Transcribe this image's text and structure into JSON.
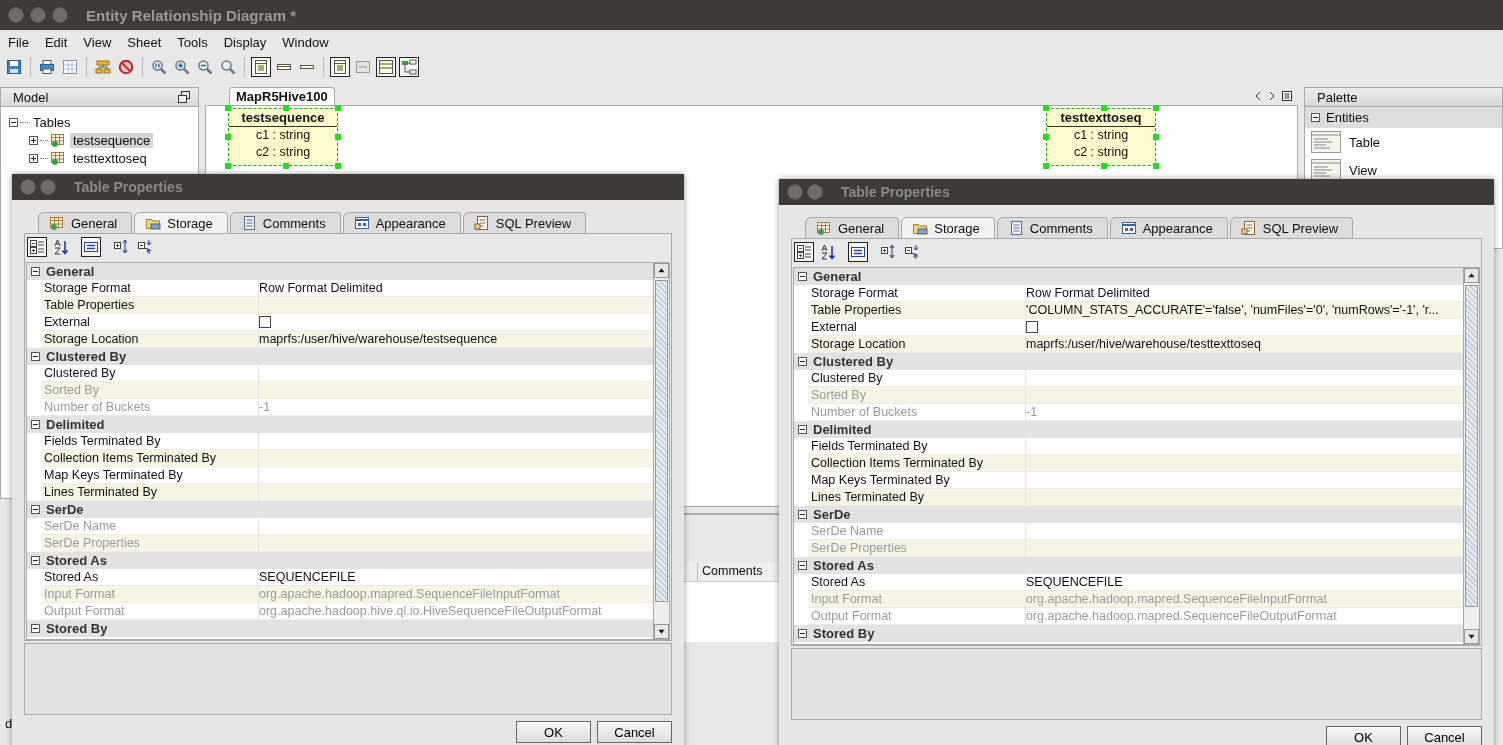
{
  "window": {
    "title": "Entity Relationship Diagram *"
  },
  "menu": [
    "File",
    "Edit",
    "View",
    "Sheet",
    "Tools",
    "Display",
    "Window"
  ],
  "toolbar": [
    {
      "kind": "save",
      "pressed": false
    },
    {
      "kind": "sep"
    },
    {
      "kind": "print",
      "pressed": false
    },
    {
      "kind": "grid",
      "pressed": false
    },
    {
      "kind": "sep"
    },
    {
      "kind": "layout",
      "pressed": false
    },
    {
      "kind": "stop",
      "pressed": false
    },
    {
      "kind": "sep"
    },
    {
      "kind": "zoomfit",
      "pressed": false
    },
    {
      "kind": "zoomin",
      "pressed": false
    },
    {
      "kind": "zoomout",
      "pressed": false
    },
    {
      "kind": "zoom",
      "pressed": false
    },
    {
      "kind": "sep"
    },
    {
      "kind": "entityfull",
      "pressed": true
    },
    {
      "kind": "entitytitle",
      "pressed": false
    },
    {
      "kind": "entityline",
      "pressed": false
    },
    {
      "kind": "sep"
    },
    {
      "kind": "entityfull",
      "pressed": true
    },
    {
      "kind": "nul",
      "pressed": false
    },
    {
      "kind": "window",
      "pressed": true
    },
    {
      "kind": "diagram",
      "pressed": true
    }
  ],
  "model_panel": {
    "title": "Model",
    "tree": [
      {
        "label": "Tables",
        "expanded": true,
        "children": [
          {
            "label": "testsequence",
            "selected": true,
            "expanded": false
          },
          {
            "label": "testtexttoseq",
            "selected": false,
            "expanded": false
          }
        ]
      }
    ]
  },
  "diagram": {
    "tab": "MapR5Hive100",
    "entities": [
      {
        "name": "testsequence",
        "columns": [
          "c1 : string",
          "c2 : string"
        ],
        "selected": true
      },
      {
        "name": "testtexttoseq",
        "columns": [
          "c1 : string",
          "c2 : string"
        ],
        "selected": true
      }
    ]
  },
  "palette": {
    "title": "Palette",
    "group": "Entities",
    "items": [
      "Table",
      "View"
    ]
  },
  "bottom_panel": {
    "column": "Comments"
  },
  "status_text": "d",
  "dialogs": [
    {
      "title": "Table Properties",
      "tabs": [
        {
          "label": "General",
          "kind": "general",
          "selected": false
        },
        {
          "label": "Storage",
          "kind": "storage",
          "selected": true
        },
        {
          "label": "Comments",
          "kind": "comments",
          "selected": false
        },
        {
          "label": "Appearance",
          "kind": "appearance",
          "selected": false
        },
        {
          "label": "SQL Preview",
          "kind": "sql",
          "selected": false
        }
      ],
      "tools": [
        {
          "kind": "categorized",
          "pressed": true
        },
        {
          "kind": "alphabetical",
          "pressed": false
        },
        {
          "kind": "description",
          "pressed": true
        },
        {
          "kind": "expand",
          "pressed": false
        },
        {
          "kind": "collapse",
          "pressed": false
        }
      ],
      "sections": [
        {
          "title": "General",
          "expanded": true,
          "rows": [
            {
              "name": "Storage Format",
              "value": "Row Format Delimited",
              "disabled": false,
              "kind": "text"
            },
            {
              "name": "Table Properties",
              "disabled": false,
              "kind": "text"
            },
            {
              "name": "External",
              "disabled": false,
              "kind": "checkbox",
              "checked": false
            },
            {
              "name": "Storage Location",
              "value": "maprfs:/user/hive/warehouse/testsequence",
              "disabled": false,
              "kind": "text"
            }
          ]
        },
        {
          "title": "Clustered By",
          "expanded": true,
          "rows": [
            {
              "name": "Clustered By",
              "disabled": false,
              "kind": "text"
            },
            {
              "name": "Sorted By",
              "disabled": true,
              "kind": "text"
            },
            {
              "name": "Number of Buckets",
              "value": "-1",
              "disabled": true,
              "kind": "text"
            }
          ]
        },
        {
          "title": "Delimited",
          "expanded": true,
          "rows": [
            {
              "name": "Fields Terminated By",
              "disabled": false,
              "kind": "text"
            },
            {
              "name": "Collection Items Terminated By",
              "disabled": false,
              "kind": "text"
            },
            {
              "name": "Map Keys Terminated By",
              "disabled": false,
              "kind": "text"
            },
            {
              "name": "Lines Terminated By",
              "disabled": false,
              "kind": "text"
            }
          ]
        },
        {
          "title": "SerDe",
          "expanded": true,
          "rows": [
            {
              "name": "SerDe Name",
              "disabled": true,
              "kind": "text"
            },
            {
              "name": "SerDe Properties",
              "disabled": true,
              "kind": "text"
            }
          ]
        },
        {
          "title": "Stored As",
          "expanded": true,
          "rows": [
            {
              "name": "Stored As",
              "value": "SEQUENCEFILE",
              "disabled": false,
              "kind": "text"
            },
            {
              "name": "Input Format",
              "value": "org.apache.hadoop.mapred.SequenceFileInputFormat",
              "disabled": true,
              "kind": "text"
            },
            {
              "name": "Output Format",
              "value": "org.apache.hadoop.hive.ql.io.HiveSequenceFileOutputFormat",
              "disabled": true,
              "kind": "text"
            }
          ]
        },
        {
          "title": "Stored By",
          "expanded": true
        }
      ],
      "buttons": [
        "OK",
        "Cancel"
      ]
    },
    {
      "title": "Table Properties",
      "tabs": [
        {
          "label": "General",
          "kind": "general",
          "selected": false
        },
        {
          "label": "Storage",
          "kind": "storage",
          "selected": true
        },
        {
          "label": "Comments",
          "kind": "comments",
          "selected": false
        },
        {
          "label": "Appearance",
          "kind": "appearance",
          "selected": false
        },
        {
          "label": "SQL Preview",
          "kind": "sql",
          "selected": false
        }
      ],
      "tools": [
        {
          "kind": "categorized",
          "pressed": true
        },
        {
          "kind": "alphabetical",
          "pressed": false
        },
        {
          "kind": "description",
          "pressed": true
        },
        {
          "kind": "expand",
          "pressed": false
        },
        {
          "kind": "collapse",
          "pressed": false
        }
      ],
      "sections": [
        {
          "title": "General",
          "expanded": true,
          "rows": [
            {
              "name": "Storage Format",
              "value": "Row Format Delimited",
              "disabled": false,
              "kind": "text"
            },
            {
              "name": "Table Properties",
              "value": "'COLUMN_STATS_ACCURATE'='false', 'numFiles'='0', 'numRows'='-1', 'r...",
              "disabled": false,
              "kind": "text"
            },
            {
              "name": "External",
              "disabled": false,
              "kind": "checkbox",
              "checked": false
            },
            {
              "name": "Storage Location",
              "value": "maprfs:/user/hive/warehouse/testtexttoseq",
              "disabled": false,
              "kind": "text"
            }
          ]
        },
        {
          "title": "Clustered By",
          "expanded": true,
          "rows": [
            {
              "name": "Clustered By",
              "disabled": false,
              "kind": "text"
            },
            {
              "name": "Sorted By",
              "disabled": true,
              "kind": "text"
            },
            {
              "name": "Number of Buckets",
              "value": "-1",
              "disabled": true,
              "kind": "text"
            }
          ]
        },
        {
          "title": "Delimited",
          "expanded": true,
          "rows": [
            {
              "name": "Fields Terminated By",
              "disabled": false,
              "kind": "text"
            },
            {
              "name": "Collection Items Terminated By",
              "disabled": false,
              "kind": "text"
            },
            {
              "name": "Map Keys Terminated By",
              "disabled": false,
              "kind": "text"
            },
            {
              "name": "Lines Terminated By",
              "disabled": false,
              "kind": "text"
            }
          ]
        },
        {
          "title": "SerDe",
          "expanded": true,
          "rows": [
            {
              "name": "SerDe Name",
              "disabled": true,
              "kind": "text"
            },
            {
              "name": "SerDe Properties",
              "disabled": true,
              "kind": "text"
            }
          ]
        },
        {
          "title": "Stored As",
          "expanded": true,
          "rows": [
            {
              "name": "Stored As",
              "value": "SEQUENCEFILE",
              "disabled": false,
              "kind": "text"
            },
            {
              "name": "Input Format",
              "value": "org.apache.hadoop.mapred.SequenceFileInputFormat",
              "disabled": true,
              "kind": "text"
            },
            {
              "name": "Output Format",
              "value": "org.apache.hadoop.mapred.SequenceFileOutputFormat",
              "disabled": true,
              "kind": "text"
            }
          ]
        },
        {
          "title": "Stored By",
          "expanded": true
        }
      ],
      "buttons": [
        "OK",
        "Cancel"
      ]
    }
  ]
}
